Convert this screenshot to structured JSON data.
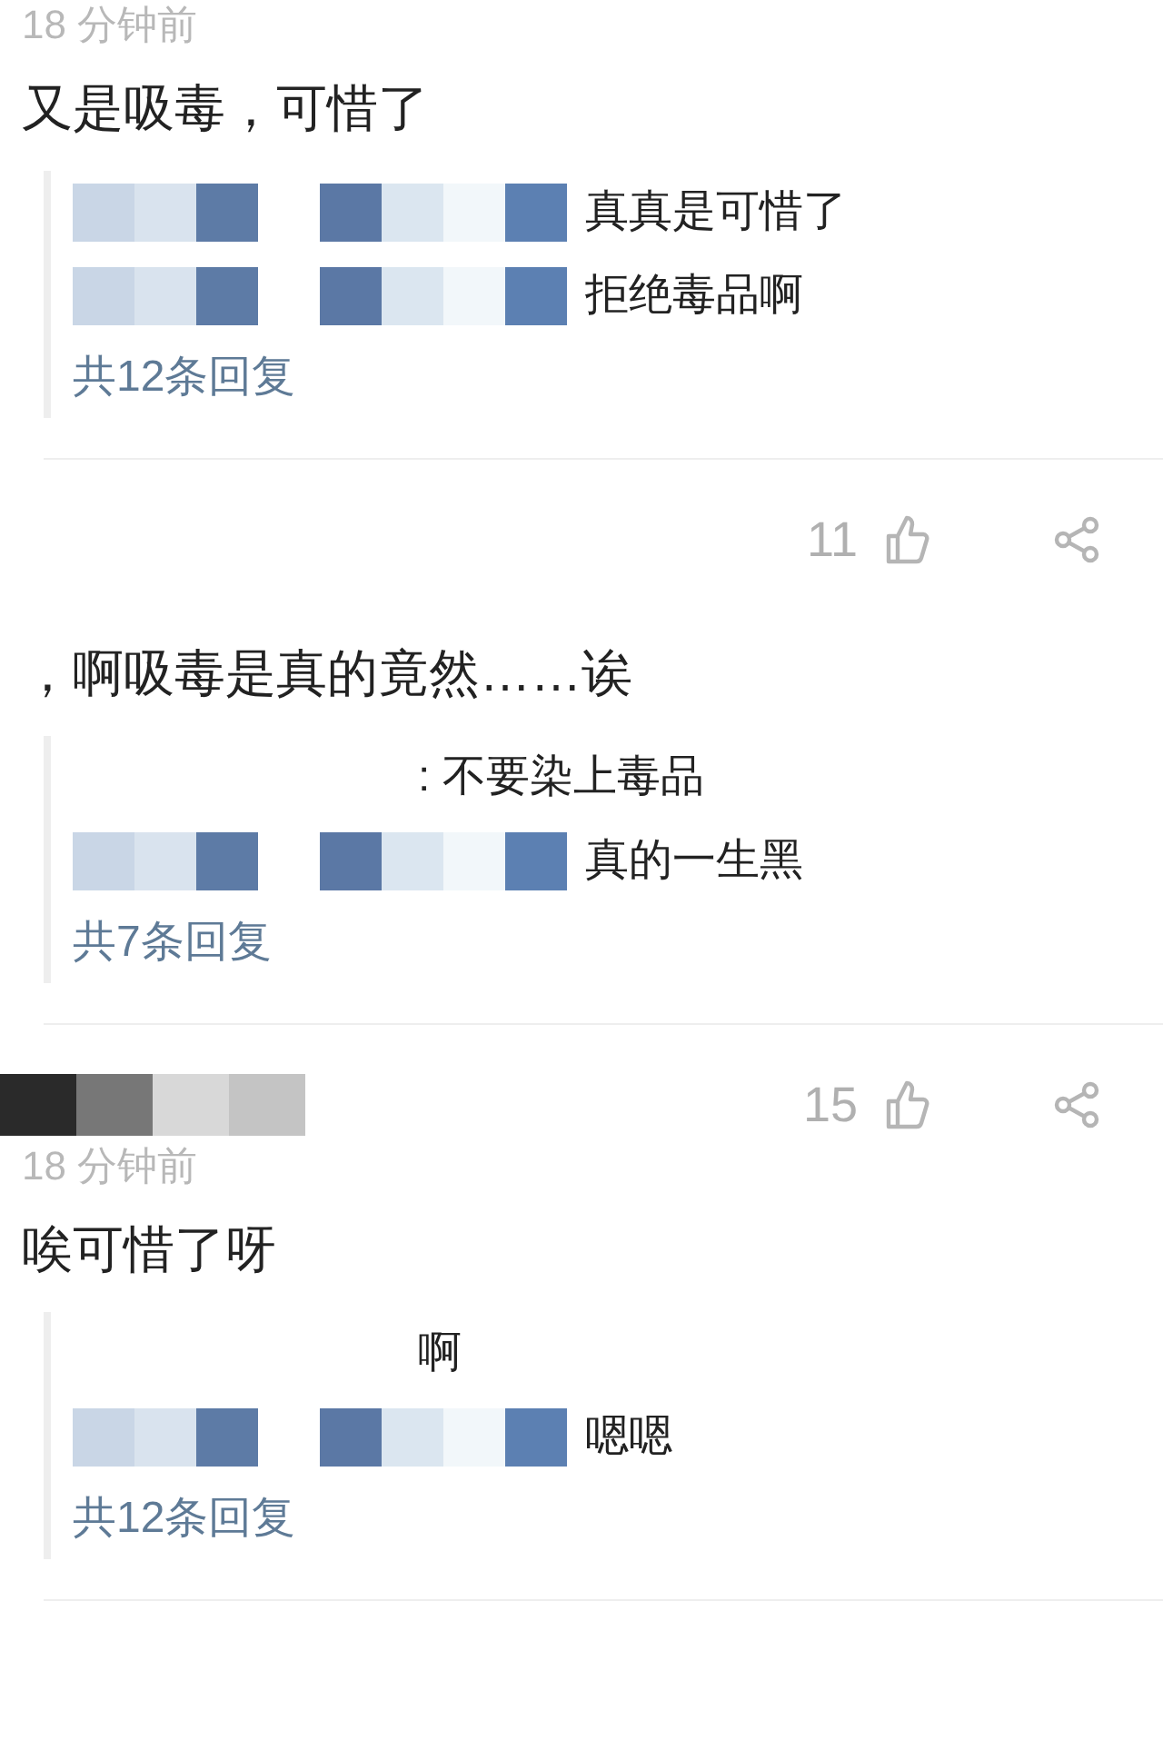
{
  "comments": [
    {
      "author_hidden": false,
      "time": "18 分钟前",
      "text": "又是吸毒，可惜了",
      "replies": [
        {
          "text": "真真是可惜了",
          "name_hidden": true
        },
        {
          "text": "拒绝毒品啊",
          "name_hidden": true
        }
      ],
      "reply_count": "共12条回复"
    },
    {
      "author_hidden": false,
      "likes": "11",
      "text": "，啊吸毒是真的竟然……诶",
      "replies": [
        {
          "text": ": 不要染上毒品",
          "name_hidden": false
        },
        {
          "text": "真的一生黑",
          "name_hidden": true
        }
      ],
      "reply_count": "共7条回复"
    },
    {
      "author_hidden": true,
      "likes": "15",
      "time": "18 分钟前",
      "text": "唉可惜了呀",
      "replies": [
        {
          "text": "啊",
          "name_hidden": false
        },
        {
          "text": "嗯嗯",
          "name_hidden": true
        }
      ],
      "reply_count": "共12条回复"
    }
  ]
}
